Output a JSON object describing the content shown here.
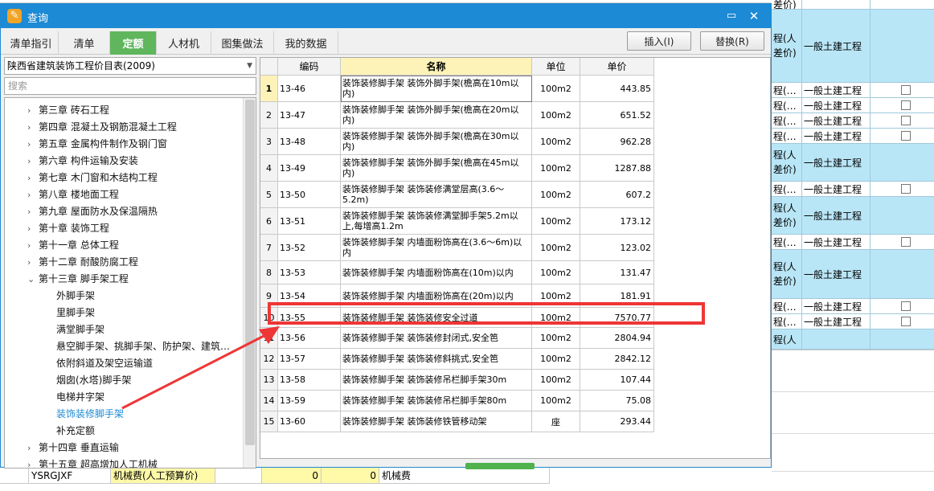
{
  "dialog": {
    "title": "查询",
    "tabs": [
      {
        "label": "清单指引"
      },
      {
        "label": "清单"
      },
      {
        "label": "定额",
        "active": true
      },
      {
        "label": "人材机"
      },
      {
        "label": "图集做法"
      },
      {
        "label": "我的数据"
      }
    ],
    "insert_label": "插入(I)",
    "replace_label": "替换(R)"
  },
  "library": {
    "selected": "陕西省建筑装饰工程价目表(2009)",
    "search_placeholder": "搜索"
  },
  "tree": [
    {
      "label": "第三章 砖石工程",
      "level": 0,
      "expanded": false
    },
    {
      "label": "第四章 混凝土及钢筋混凝土工程",
      "level": 0,
      "expanded": false
    },
    {
      "label": "第五章 金属构件制作及钢门窗",
      "level": 0,
      "expanded": false
    },
    {
      "label": "第六章 构件运输及安装",
      "level": 0,
      "expanded": false
    },
    {
      "label": "第七章 木门窗和木结构工程",
      "level": 0,
      "expanded": false
    },
    {
      "label": "第八章 楼地面工程",
      "level": 0,
      "expanded": false
    },
    {
      "label": "第九章 屋面防水及保温隔热",
      "level": 0,
      "expanded": false
    },
    {
      "label": "第十章 装饰工程",
      "level": 0,
      "expanded": false
    },
    {
      "label": "第十一章 总体工程",
      "level": 0,
      "expanded": false
    },
    {
      "label": "第十二章 耐酸防腐工程",
      "level": 0,
      "expanded": false
    },
    {
      "label": "第十三章 脚手架工程",
      "level": 0,
      "expanded": true
    },
    {
      "label": "外脚手架",
      "level": 1
    },
    {
      "label": "里脚手架",
      "level": 1
    },
    {
      "label": "满堂脚手架",
      "level": 1
    },
    {
      "label": "悬空脚手架、挑脚手架、防护架、建筑…",
      "level": 1
    },
    {
      "label": "依附斜道及架空运输道",
      "level": 1
    },
    {
      "label": "烟囱(水塔)脚手架",
      "level": 1
    },
    {
      "label": "电梯井字架",
      "level": 1
    },
    {
      "label": "装饰装修脚手架",
      "level": 1,
      "selected": true
    },
    {
      "label": "补充定额",
      "level": 1
    },
    {
      "label": "第十四章 垂直运输",
      "level": 0,
      "expanded": false
    },
    {
      "label": "第十五章 超高增加人工机械",
      "level": 0,
      "expanded": false
    }
  ],
  "grid": {
    "columns": [
      "编码",
      "名称",
      "单位",
      "单价"
    ],
    "rows": [
      {
        "idx": "1",
        "code": "13-46",
        "name": "装饰装修脚手架 装饰外脚手架(檐高在10m以内)",
        "unit": "100m2",
        "price": "443.85"
      },
      {
        "idx": "2",
        "code": "13-47",
        "name": "装饰装修脚手架 装饰外脚手架(檐高在20m以内)",
        "unit": "100m2",
        "price": "651.52"
      },
      {
        "idx": "3",
        "code": "13-48",
        "name": "装饰装修脚手架 装饰外脚手架(檐高在30m以内)",
        "unit": "100m2",
        "price": "962.28"
      },
      {
        "idx": "4",
        "code": "13-49",
        "name": "装饰装修脚手架 装饰外脚手架(檐高在45m以内)",
        "unit": "100m2",
        "price": "1287.88"
      },
      {
        "idx": "5",
        "code": "13-50",
        "name": "装饰装修脚手架 装饰装修满堂层高(3.6～5.2m)",
        "unit": "100m2",
        "price": "607.2"
      },
      {
        "idx": "6",
        "code": "13-51",
        "name": "装饰装修脚手架 装饰装修满堂脚手架5.2m以上,每增高1.2m",
        "unit": "100m2",
        "price": "173.12"
      },
      {
        "idx": "7",
        "code": "13-52",
        "name": "装饰装修脚手架 内墙面粉饰高在(3.6～6m)以内",
        "unit": "100m2",
        "price": "123.02"
      },
      {
        "idx": "8",
        "code": "13-53",
        "name": "装饰装修脚手架 内墙面粉饰高在(10m)以内",
        "unit": "100m2",
        "price": "131.47"
      },
      {
        "idx": "9",
        "code": "13-54",
        "name": "装饰装修脚手架 内墙面粉饰高在(20m)以内",
        "unit": "100m2",
        "price": "181.91"
      },
      {
        "idx": "10",
        "code": "13-55",
        "name": "装饰装修脚手架 装饰装修安全过道",
        "unit": "100m2",
        "price": "7570.77"
      },
      {
        "idx": "11",
        "code": "13-56",
        "name": "装饰装修脚手架 装饰装修封闭式,安全笆",
        "unit": "100m2",
        "price": "2804.94"
      },
      {
        "idx": "12",
        "code": "13-57",
        "name": "装饰装修脚手架 装饰装修斜挑式,安全笆",
        "unit": "100m2",
        "price": "2842.12"
      },
      {
        "idx": "13",
        "code": "13-58",
        "name": "装饰装修脚手架 装饰装修吊栏脚手架30m",
        "unit": "100m2",
        "price": "107.44"
      },
      {
        "idx": "14",
        "code": "13-59",
        "name": "装饰装修脚手架 装饰装修吊栏脚手架80m",
        "unit": "100m2",
        "price": "75.08"
      },
      {
        "idx": "15",
        "code": "13-60",
        "name": "装饰装修脚手架 装饰装修铁管移动架",
        "unit": "座",
        "price": "293.44"
      }
    ]
  },
  "background": {
    "right_rows": [
      {
        "c1": "差价)",
        "c2": "",
        "style": "white",
        "checkbox": false
      },
      {
        "c1": "程(人差价)",
        "c2": "一般土建工程",
        "style": "blue",
        "checkbox": false
      },
      {
        "c1": "程(…",
        "c2": "一般土建工程",
        "style": "white",
        "checkbox": true
      },
      {
        "c1": "程(…",
        "c2": "一般土建工程",
        "style": "white",
        "checkbox": true
      },
      {
        "c1": "程(…",
        "c2": "一般土建工程",
        "style": "white",
        "checkbox": true
      },
      {
        "c1": "程(…",
        "c2": "一般土建工程",
        "style": "white",
        "checkbox": true
      },
      {
        "c1": "程(人差价)",
        "c2": "一般土建工程",
        "style": "blue",
        "checkbox": false
      },
      {
        "c1": "程(…",
        "c2": "一般土建工程",
        "style": "white",
        "checkbox": true
      },
      {
        "c1": "程(人差价)",
        "c2": "一般土建工程",
        "style": "blue",
        "checkbox": false
      },
      {
        "c1": "程(…",
        "c2": "一般土建工程",
        "style": "white",
        "checkbox": true
      },
      {
        "c1": "程(人差价)",
        "c2": "一般土建工程",
        "style": "blue",
        "checkbox": false
      },
      {
        "c1": "程(…",
        "c2": "一般土建工程",
        "style": "white",
        "checkbox": true
      },
      {
        "c1": "程(…",
        "c2": "一般土建工程",
        "style": "white",
        "checkbox": true
      },
      {
        "c1": "程(人",
        "c2": "",
        "style": "blue",
        "checkbox": false
      }
    ],
    "bottom_row": {
      "code": "YSRGJXF",
      "name": "机械费(人工预算价)",
      "v1": "0",
      "v2": "0",
      "desc": "机械费"
    }
  }
}
